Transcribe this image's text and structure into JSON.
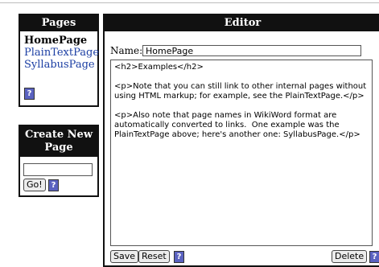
{
  "pages_panel": {
    "title": "Pages",
    "current": "HomePage",
    "links": [
      "PlainTextPage",
      "SyllabusPage"
    ],
    "help": "?"
  },
  "create_panel": {
    "title_line1": "Create New",
    "title_line2": "Page",
    "input_value": "",
    "go_label": "Go!",
    "help": "?"
  },
  "editor": {
    "title": "Editor",
    "name_label": "Name:",
    "name_value": "HomePage",
    "content": "<h2>Examples</h2>\n\n<p>Note that you can still link to other internal pages without using HTML markup; for example, see the PlainTextPage.</p>\n\n<p>Also note that page names in WikiWord format are automatically converted to links.  One example was the PlainTextPage above; here's another one: SyllabusPage.</p>",
    "save_label": "Save",
    "reset_label": "Reset",
    "delete_label": "Delete",
    "help": "?"
  },
  "colors": {
    "header_bg": "#111111",
    "link": "#1b3ea3",
    "help_bg": "#5a62c0"
  }
}
